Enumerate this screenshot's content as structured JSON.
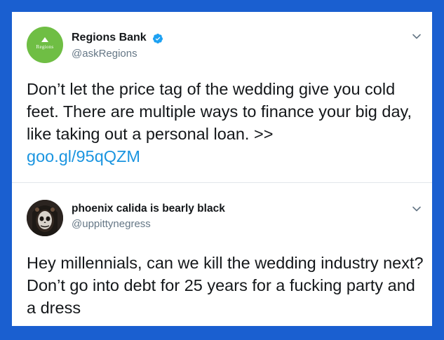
{
  "tweets": [
    {
      "display_name": "Regions Bank",
      "handle": "@askRegions",
      "avatar_text": "Regions",
      "verified": true,
      "text": "Don’t let the price tag of the wedding give you cold feet. There are multiple ways to finance your big day, like taking out a personal loan. >>",
      "link": "goo.gl/95qQZM"
    },
    {
      "display_name": "phoenix calida is bearly black",
      "handle": "@uppittynegress",
      "text": "Hey millennials, can we kill the wedding industry next? Don’t go into debt for 25 years for a fucking party and a dress"
    }
  ],
  "colors": {
    "frame": "#1a5fd0",
    "link": "#1b95e0",
    "verified": "#1da1f2",
    "regions_green": "#6fbe44"
  },
  "icons": [
    "verified-badge-icon",
    "chevron-down-icon"
  ]
}
